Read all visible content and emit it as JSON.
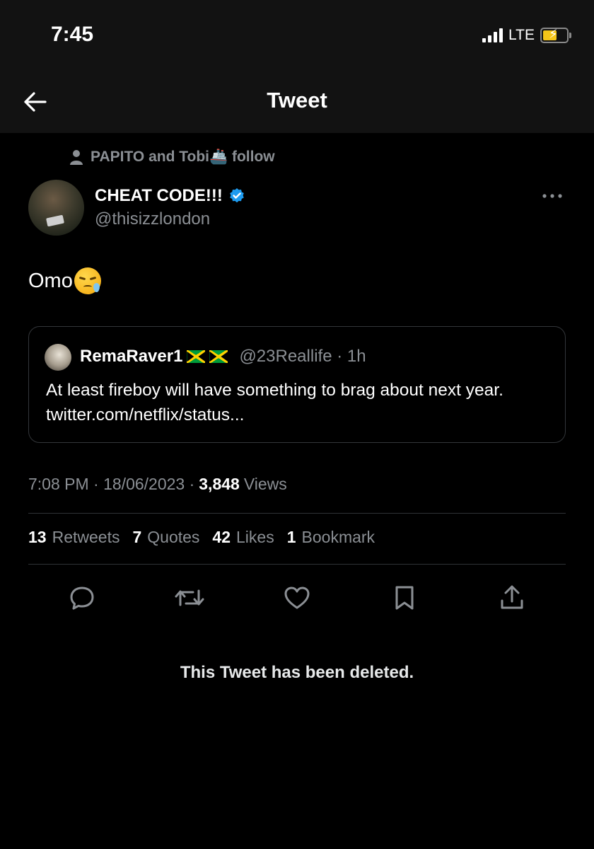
{
  "status_bar": {
    "time": "7:45",
    "network": "LTE"
  },
  "header": {
    "title": "Tweet"
  },
  "social_context": {
    "text": "PAPITO and Tobi🚢 follow"
  },
  "author": {
    "name": "CHEAT CODE!!!",
    "handle": "@thisizzlondon",
    "verified": true
  },
  "tweet": {
    "text": "Omo",
    "emoji": "crying-face-emoji"
  },
  "quote": {
    "name": "RemaRaver1",
    "handle": "@23Reallife · 1h",
    "text": "At least fireboy will have something to brag about next year. twitter.com/netflix/status..."
  },
  "meta": {
    "time_date": "7:08 PM · 18/06/2023 ·",
    "views_count": "3,848",
    "views_label": "Views"
  },
  "stats": [
    {
      "count": "13",
      "label": "Retweets"
    },
    {
      "count": "7",
      "label": "Quotes"
    },
    {
      "count": "42",
      "label": "Likes"
    },
    {
      "count": "1",
      "label": "Bookmark"
    }
  ],
  "actions": [
    "reply-icon",
    "retweet-icon",
    "like-icon",
    "bookmark-icon",
    "share-icon"
  ],
  "deleted_notice": "This Tweet has been deleted.",
  "colors": {
    "background": "#000000",
    "header": "#121212",
    "secondary_text": "#8b8f94",
    "verified": "#1d9bf0",
    "divider": "#2f3336"
  }
}
